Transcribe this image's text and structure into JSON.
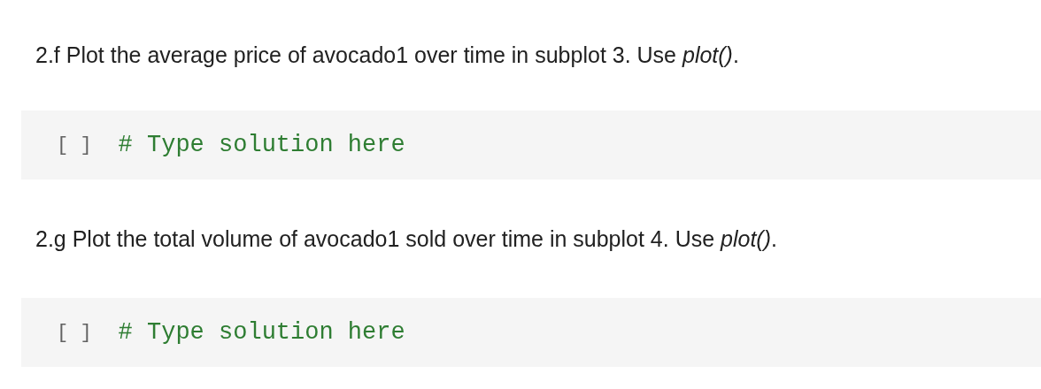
{
  "cells": [
    {
      "kind": "text",
      "text": "2.f Plot the average price of avocado1 over time in subplot 3. Use *plot()*."
    },
    {
      "kind": "code",
      "prompt": "[ ]",
      "code": "# Type solution here"
    },
    {
      "kind": "text",
      "text": "2.g Plot the total volume of avocado1 sold over time in subplot 4. Use *plot()*."
    },
    {
      "kind": "code",
      "prompt": "[ ]",
      "code": "# Type solution here"
    }
  ]
}
